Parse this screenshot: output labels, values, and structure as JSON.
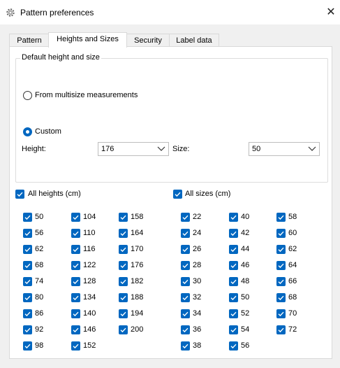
{
  "window": {
    "title": "Pattern preferences",
    "icon": "gear-icon",
    "close_glyph": "✕"
  },
  "tabs": [
    {
      "label": "Pattern",
      "active": false
    },
    {
      "label": "Heights and Sizes",
      "active": true
    },
    {
      "label": "Security",
      "active": false
    },
    {
      "label": "Label data",
      "active": false
    }
  ],
  "default_group": {
    "legend": "Default height and size",
    "radio_multisize": {
      "label": "From multisize measurements",
      "selected": false
    },
    "radio_custom": {
      "label": "Custom",
      "selected": true
    },
    "height_label": "Height:",
    "height_value": "176",
    "size_label": "Size:",
    "size_value": "50"
  },
  "heights": {
    "all_label": "All heights (cm)",
    "values": [
      "50",
      "56",
      "62",
      "68",
      "74",
      "80",
      "86",
      "92",
      "98",
      "104",
      "110",
      "116",
      "122",
      "128",
      "134",
      "140",
      "146",
      "152",
      "158",
      "164",
      "170",
      "176",
      "182",
      "188",
      "194",
      "200"
    ]
  },
  "sizes": {
    "all_label": "All sizes (cm)",
    "values": [
      "22",
      "24",
      "26",
      "28",
      "30",
      "32",
      "34",
      "36",
      "38",
      "40",
      "42",
      "44",
      "46",
      "48",
      "50",
      "52",
      "54",
      "56",
      "58",
      "60",
      "62",
      "64",
      "66",
      "68",
      "70",
      "72"
    ]
  },
  "colors": {
    "accent": "#0067c0",
    "panel": "#ffffff",
    "window": "#f0f0f0"
  }
}
